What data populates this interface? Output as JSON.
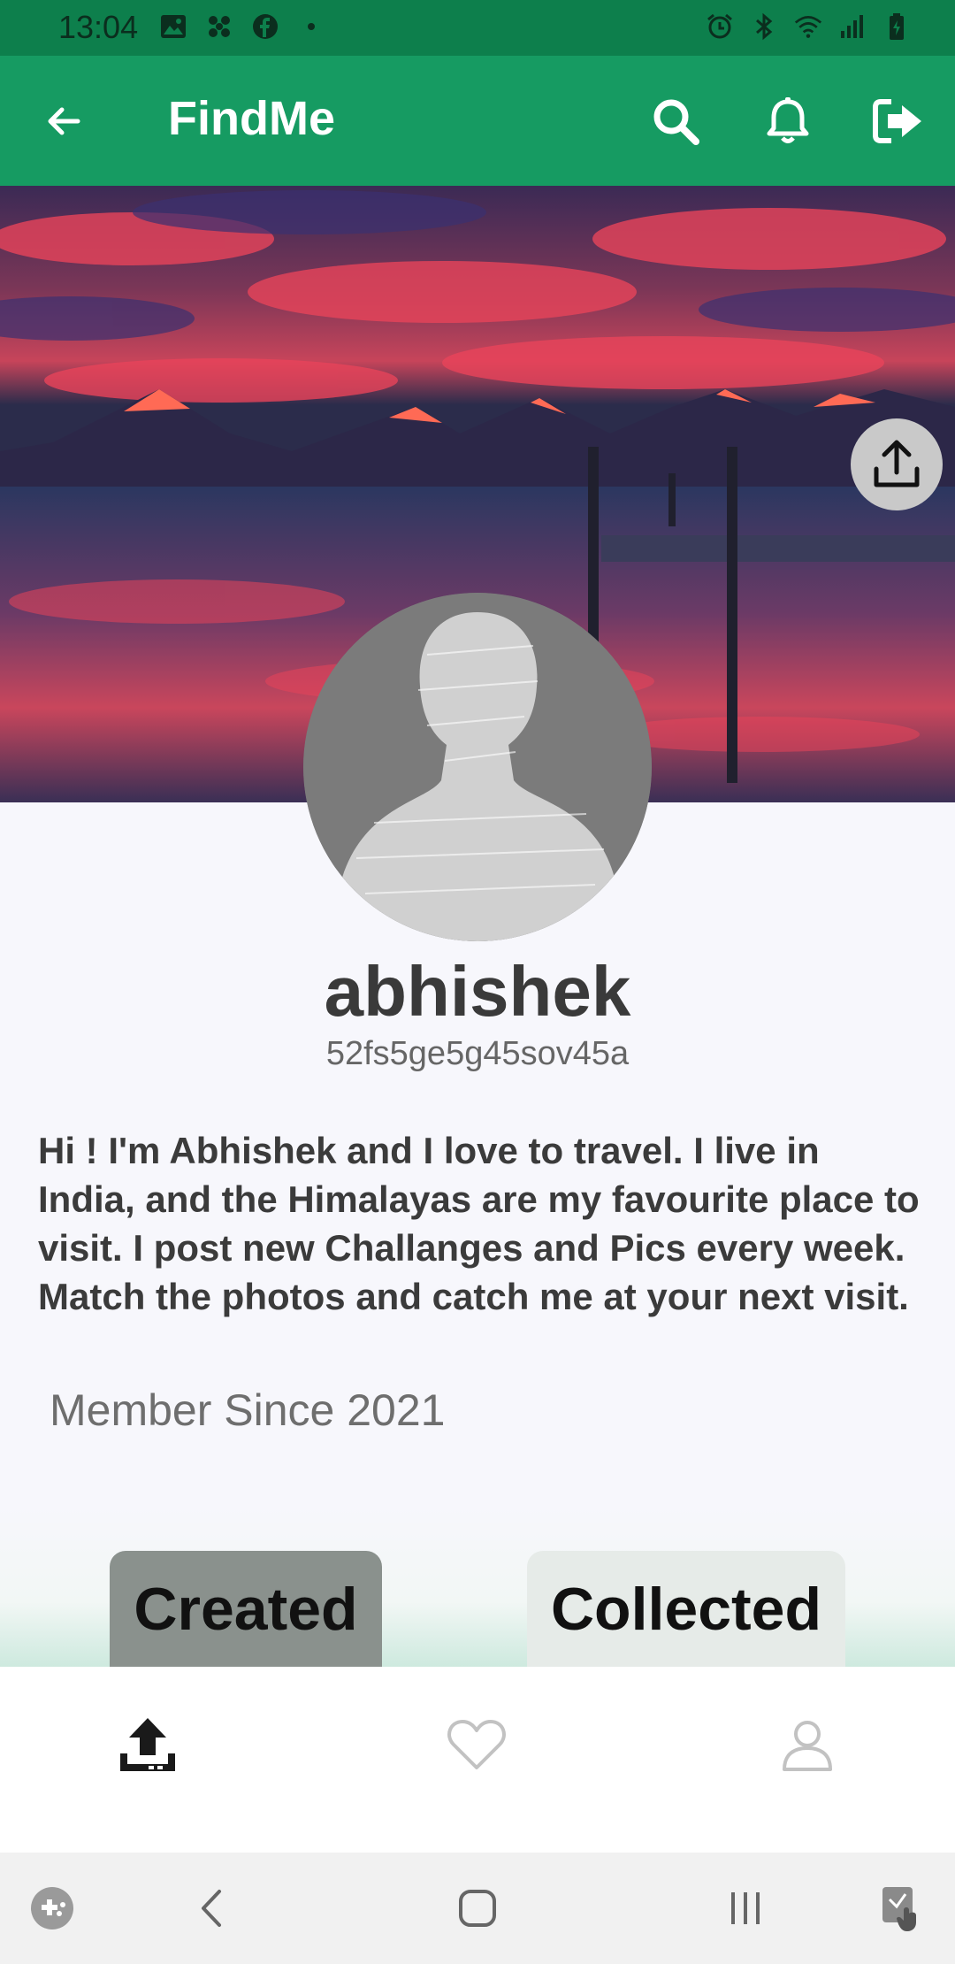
{
  "status_bar": {
    "time": "13:04",
    "left_icons": [
      "gallery-icon",
      "pinwheel-icon",
      "facebook-icon",
      "dot-icon"
    ],
    "right_icons": [
      "alarm-icon",
      "bluetooth-icon",
      "wifi-icon",
      "signal-icon",
      "battery-icon"
    ]
  },
  "app_bar": {
    "title": "FindMe",
    "icons": [
      "back-arrow-icon",
      "search-icon",
      "bell-icon",
      "logout-icon"
    ],
    "color": "#169b62"
  },
  "profile": {
    "username": "abhishek",
    "user_id": "52fs5ge5g45sov45a",
    "bio": "Hi ! I'm Abhishek and I love to travel. I live in India, and the Himalayas are my favourite place to visit. I post new Challanges and Pics every week. Match the photos and catch me at your next visit.",
    "member_since": "Member Since 2021"
  },
  "tabs": [
    {
      "label": "Created",
      "selected": true
    },
    {
      "label": "Collected",
      "selected": false
    }
  ],
  "bottom_nav": [
    "upload-icon",
    "heart-icon",
    "person-icon"
  ],
  "system_nav": [
    "game-launcher-icon",
    "back-icon",
    "home-icon",
    "recents-icon",
    "accessibility-icon"
  ]
}
